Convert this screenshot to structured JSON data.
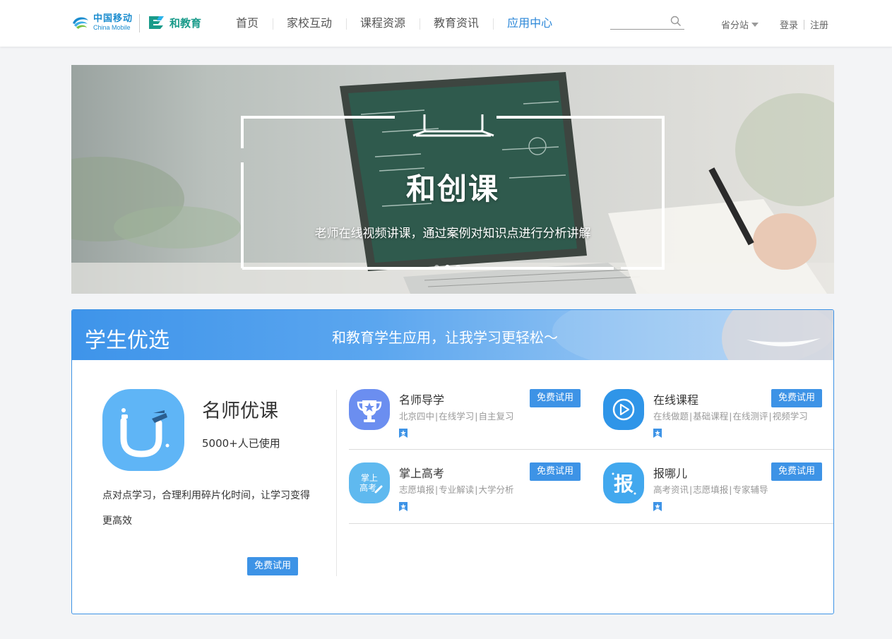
{
  "header": {
    "logo_cn": "中国移动",
    "logo_en": "China Mobile",
    "brand": "和教育",
    "nav": [
      {
        "label": "首页",
        "active": false
      },
      {
        "label": "家校互动",
        "active": false
      },
      {
        "label": "课程资源",
        "active": false
      },
      {
        "label": "教育资讯",
        "active": false
      },
      {
        "label": "应用中心",
        "active": true
      }
    ],
    "search": {
      "value": "",
      "placeholder": ""
    },
    "province": "省分站",
    "login": "登录",
    "register": "注册"
  },
  "banner": {
    "title": "和创课",
    "subtitle": "老师在线视频讲课，通过案例对知识点进行分析讲解",
    "slides": 3,
    "active_slide": 2
  },
  "section": {
    "title": "学生优选",
    "slogan": "和教育学生应用，让我学习更轻松～",
    "featured": {
      "name": "名师优课",
      "users": "5000+人已使用",
      "description": "点对点学习，合理利用碎片化时间，让学习变得更高效",
      "button": "免费试用",
      "icon": "u-logo-icon"
    },
    "apps": [
      {
        "name": "名师导学",
        "tags": [
          "北京四中",
          "在线学习",
          "自主复习"
        ],
        "button": "免费试用",
        "icon": "trophy-icon"
      },
      {
        "name": "在线课程",
        "tags": [
          "在线做题",
          "基础课程",
          "在线测评",
          "视频学习"
        ],
        "button": "免费试用",
        "icon": "play-icon"
      },
      {
        "name": "掌上高考",
        "tags": [
          "志愿填报",
          "专业解读",
          "大学分析"
        ],
        "button": "免费试用",
        "icon": "gaokao-icon",
        "icon_text": "掌上高考"
      },
      {
        "name": "报哪儿",
        "tags": [
          "高考资讯",
          "志愿填报",
          "专家辅导"
        ],
        "button": "免费试用",
        "icon": "baoner-icon",
        "icon_text": "报"
      }
    ]
  },
  "colors": {
    "accent": "#3d93e6",
    "nav_active": "#2b87d8",
    "brand_green": "#1a9b8a",
    "cm_blue": "#1a8ccf"
  }
}
